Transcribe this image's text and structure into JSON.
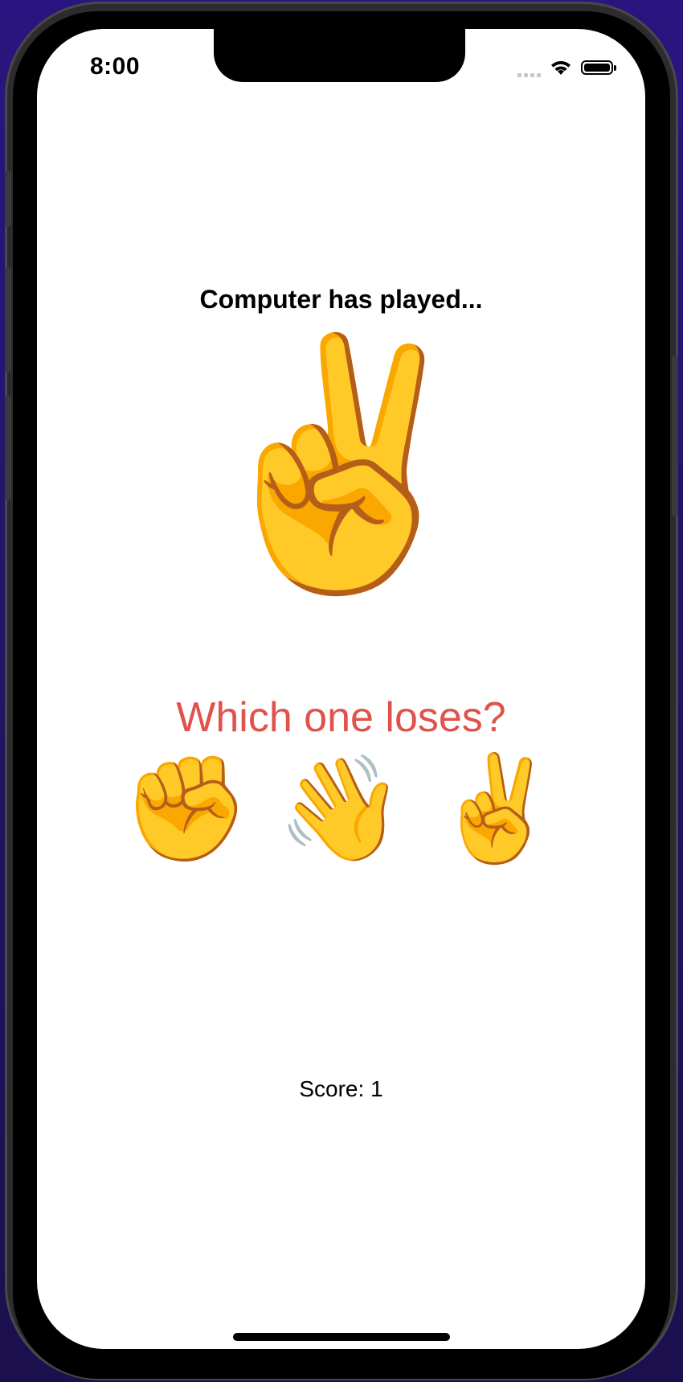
{
  "status_bar": {
    "time": "8:00",
    "icons": [
      "signal-icon",
      "wifi-icon",
      "battery-icon"
    ]
  },
  "game": {
    "prompt": "Computer has played...",
    "computer_move": "✌️",
    "question": "Which one loses?",
    "choices": [
      {
        "name": "rock",
        "emoji": "✊"
      },
      {
        "name": "paper",
        "emoji": "👋"
      },
      {
        "name": "scissors",
        "emoji": "✌️"
      }
    ],
    "score": "Score: 1"
  },
  "colors": {
    "question_text": "#e0524a",
    "background_outer": "#241466",
    "screen": "#ffffff"
  }
}
